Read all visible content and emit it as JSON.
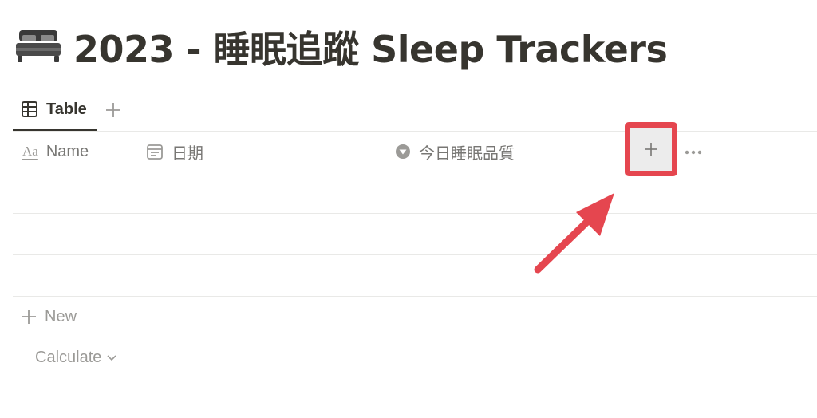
{
  "page": {
    "title": "2023 - 睡眠追蹤 Sleep Trackers",
    "title_icon": "bed-icon"
  },
  "views": {
    "tabs": [
      {
        "label": "Table",
        "icon": "table-icon",
        "active": true
      }
    ],
    "add_view_icon": "plus-icon"
  },
  "table": {
    "columns": [
      {
        "label": "Name",
        "icon": "text-aa-icon",
        "icon_text": "Aa"
      },
      {
        "label": "日期",
        "icon": "calendar-icon"
      },
      {
        "label": "今日睡眠品質",
        "icon": "select-icon"
      }
    ],
    "rows": [
      [
        "",
        "",
        ""
      ],
      [
        "",
        "",
        ""
      ],
      [
        "",
        "",
        ""
      ]
    ],
    "add_column_icon": "plus-icon",
    "more_icon": "more-horizontal-icon",
    "new_label": "New",
    "calculate_label": "Calculate"
  },
  "annotation": {
    "highlight_color": "#e5464f",
    "arrow_color": "#e5464f"
  }
}
